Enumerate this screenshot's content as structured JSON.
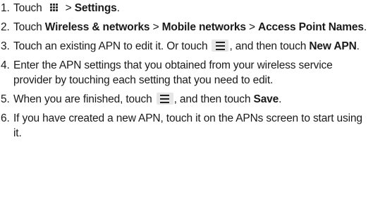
{
  "steps": [
    {
      "number": "1.",
      "parts": [
        "Touch",
        ">",
        "Settings",
        "."
      ]
    },
    {
      "number": "2.",
      "parts": [
        "Touch ",
        "Wireless & networks",
        " > ",
        "Mobile networks",
        " > ",
        "Access Point Names",
        "."
      ]
    },
    {
      "number": "3.",
      "parts": [
        "Touch an existing APN to edit it. Or touch",
        ", and then touch ",
        "New APN",
        "."
      ]
    },
    {
      "number": "4.",
      "parts": [
        "Enter the APN settings that you obtained from your wireless service provider by touching each setting that you need to edit."
      ]
    },
    {
      "number": "5.",
      "parts": [
        "When you are finished, touch",
        ", and then touch ",
        "Save",
        "."
      ]
    },
    {
      "number": "6.",
      "parts": [
        "If you have created a new APN, touch it on the APNs screen to start using it."
      ]
    }
  ],
  "icons": {
    "apps": "all-apps-grid-icon",
    "menu": "menu-icon"
  }
}
